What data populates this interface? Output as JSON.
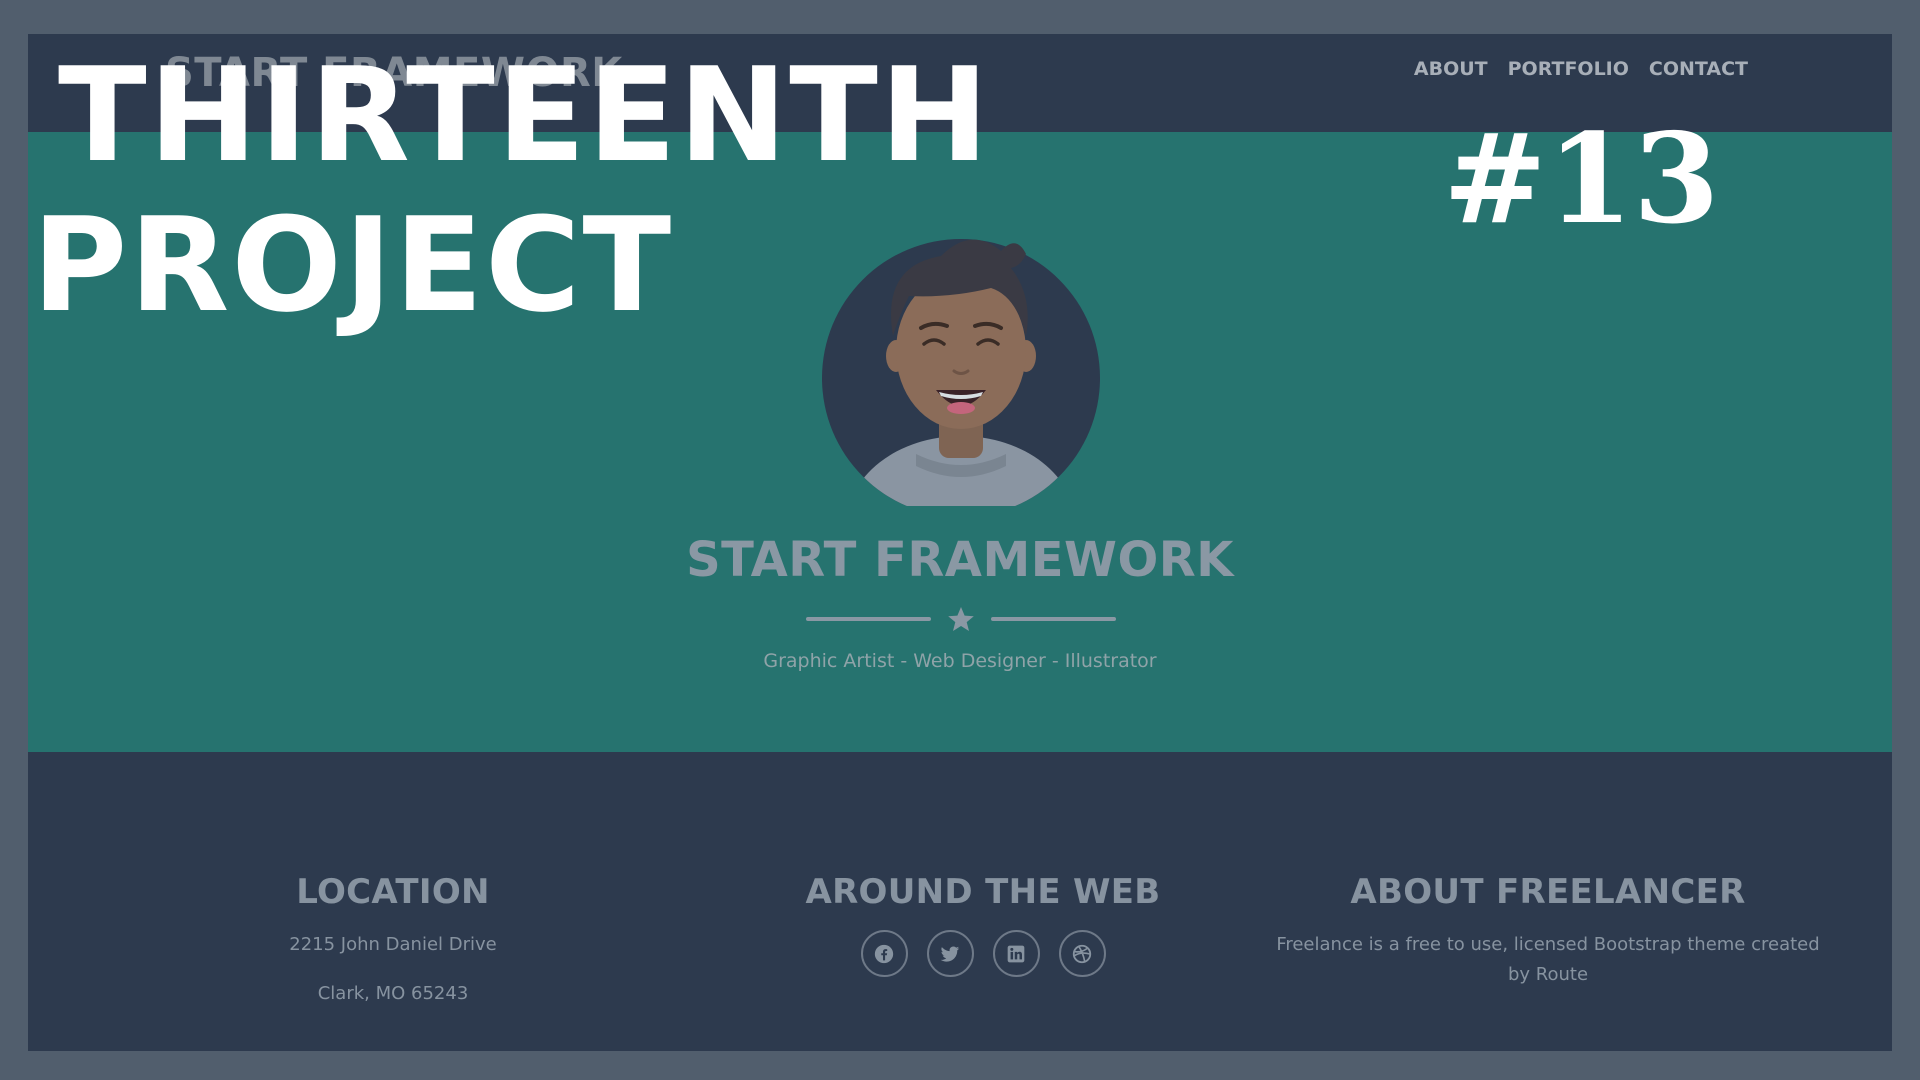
{
  "navbar": {
    "brand": "START FRAMEWORK",
    "links": [
      "ABOUT",
      "PORTFOLIO",
      "CONTACT"
    ]
  },
  "hero": {
    "title": "START FRAMEWORK",
    "tagline": "Graphic Artist - Web Designer - Illustrator",
    "avatar_icon": "smiling-man-avatar",
    "divider_icon": "star-icon"
  },
  "footer": {
    "location": {
      "title": "LOCATION",
      "line1": "2215 John Daniel Drive",
      "line2": "Clark, MO 65243"
    },
    "web": {
      "title": "AROUND THE WEB",
      "icons": [
        "facebook-icon",
        "twitter-icon",
        "linkedin-icon",
        "dribbble-icon"
      ]
    },
    "about": {
      "title": "ABOUT FREELANCER",
      "text": "Freelance is a free to use, licensed Bootstrap theme created by Route"
    }
  },
  "overlay": {
    "title_line1": "THIRTEENTH",
    "title_line2": "PROJECT",
    "number": "#13"
  },
  "colors": {
    "outer_border": "#515e6d",
    "navbar_bg": "#2d3a4e",
    "hero_bg": "#26736f",
    "overlay_text": "#ffffff"
  }
}
